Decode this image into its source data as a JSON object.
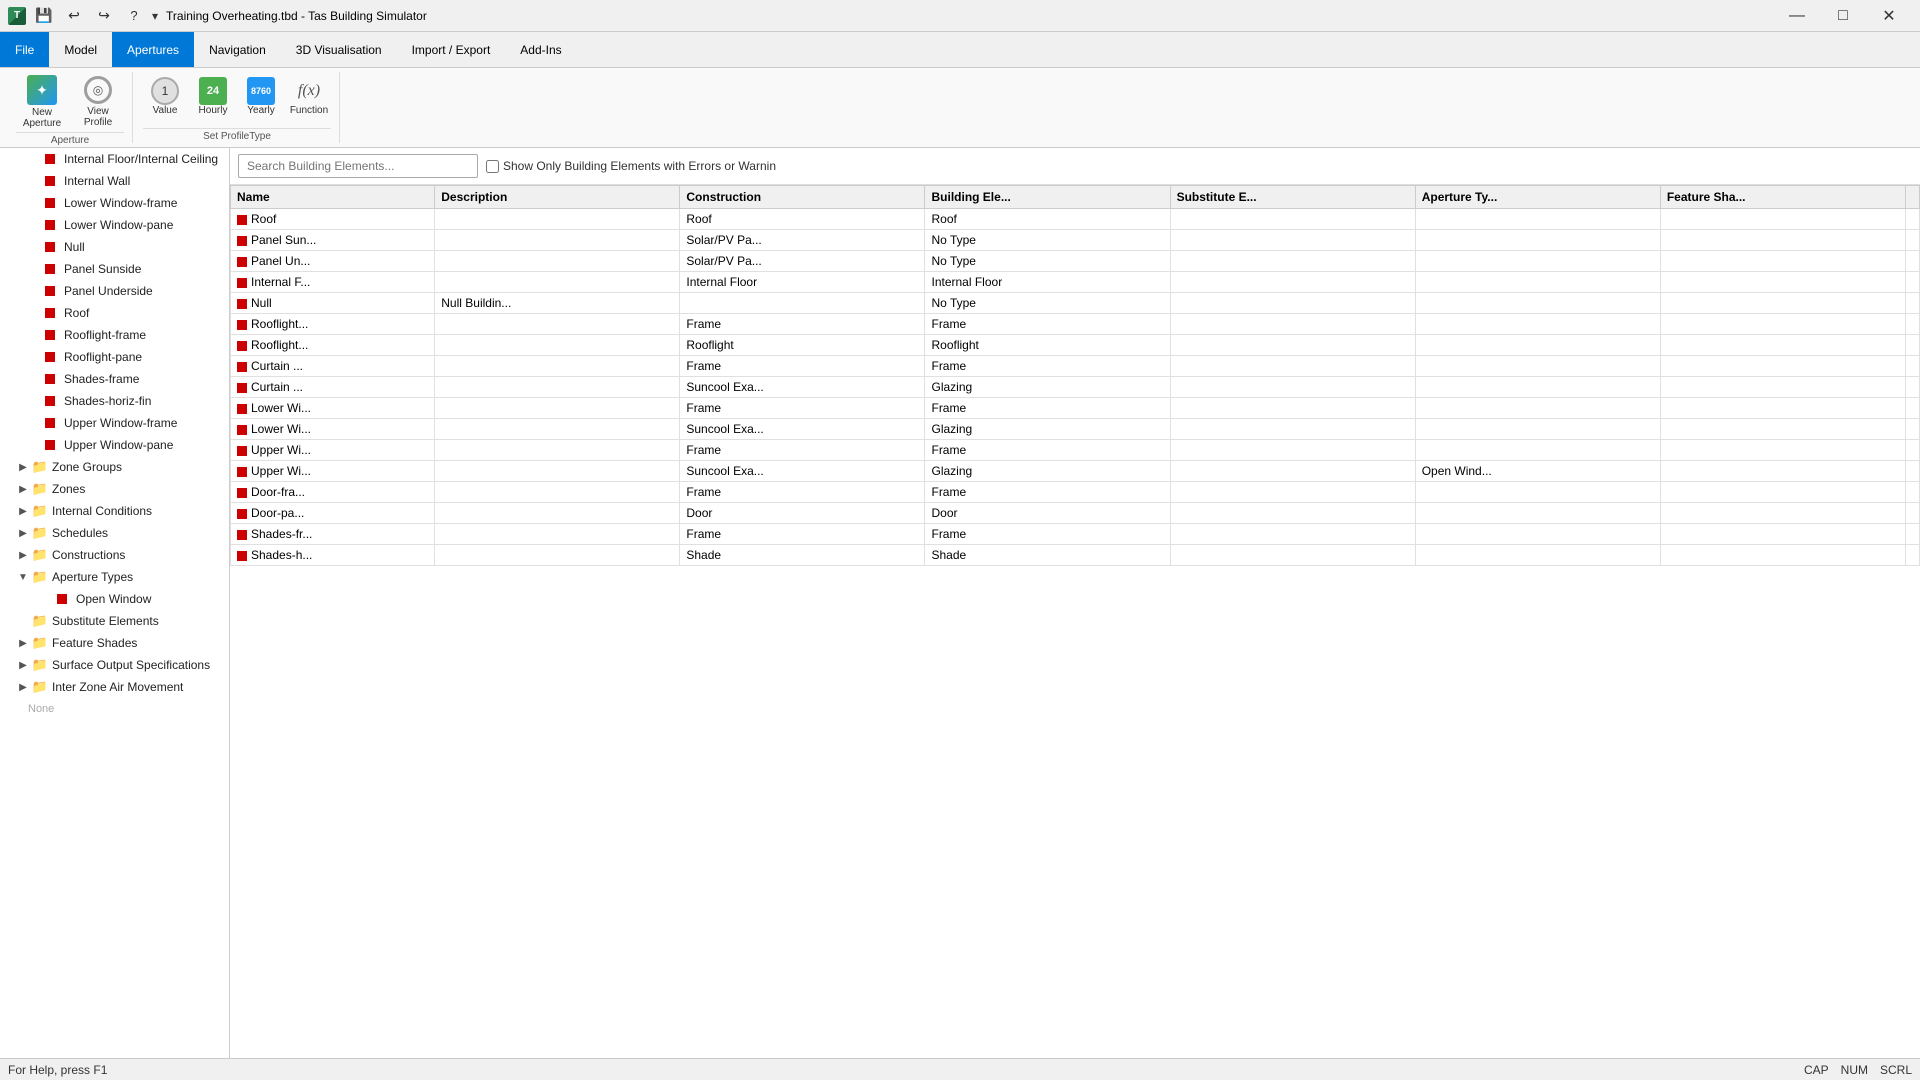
{
  "titleBar": {
    "title": "Training Overheating.tbd - Tas Building Simulator",
    "minimize": "—",
    "maximize": "□",
    "close": "✕"
  },
  "menuBar": {
    "items": [
      {
        "id": "file",
        "label": "File",
        "active": false
      },
      {
        "id": "model",
        "label": "Model",
        "active": false
      },
      {
        "id": "apertures",
        "label": "Apertures",
        "active": true
      },
      {
        "id": "navigation",
        "label": "Navigation",
        "active": false
      },
      {
        "id": "3d-vis",
        "label": "3D Visualisation",
        "active": false
      },
      {
        "id": "import-export",
        "label": "Import / Export",
        "active": false
      },
      {
        "id": "add-ins",
        "label": "Add-Ins",
        "active": false
      }
    ]
  },
  "ribbon": {
    "apertureGroup": {
      "label": "Aperture",
      "newApertureLabel": "New\nAperture",
      "viewProfileLabel": "View\nProfile"
    },
    "setProfileGroup": {
      "label": "Set ProfileType",
      "valueLabel": "Value",
      "hourlyLabel": "Hourly",
      "yearlyLabel": "Yearly",
      "functionLabel": "Function"
    }
  },
  "sidebar": {
    "items": [
      {
        "id": "internal-floor",
        "label": "Internal Floor/Internal Ceiling",
        "indent": 2,
        "type": "item",
        "icon": "red-sq"
      },
      {
        "id": "internal-wall",
        "label": "Internal Wall",
        "indent": 2,
        "type": "item",
        "icon": "red-sq"
      },
      {
        "id": "lower-window-frame",
        "label": "Lower Window-frame",
        "indent": 2,
        "type": "item",
        "icon": "red-sq"
      },
      {
        "id": "lower-window-pane",
        "label": "Lower Window-pane",
        "indent": 2,
        "type": "item",
        "icon": "red-sq"
      },
      {
        "id": "null",
        "label": "Null",
        "indent": 2,
        "type": "item",
        "icon": "red-sq"
      },
      {
        "id": "panel-sunside",
        "label": "Panel Sunside",
        "indent": 2,
        "type": "item",
        "icon": "red-sq"
      },
      {
        "id": "panel-underside",
        "label": "Panel Underside",
        "indent": 2,
        "type": "item",
        "icon": "red-sq"
      },
      {
        "id": "roof",
        "label": "Roof",
        "indent": 2,
        "type": "item",
        "icon": "red-sq"
      },
      {
        "id": "rooflight-frame",
        "label": "Rooflight-frame",
        "indent": 2,
        "type": "item",
        "icon": "red-sq"
      },
      {
        "id": "rooflight-pane",
        "label": "Rooflight-pane",
        "indent": 2,
        "type": "item",
        "icon": "red-sq"
      },
      {
        "id": "shades-frame",
        "label": "Shades-frame",
        "indent": 2,
        "type": "item",
        "icon": "red-sq"
      },
      {
        "id": "shades-horiz-fin",
        "label": "Shades-horiz-fin",
        "indent": 2,
        "type": "item",
        "icon": "red-sq"
      },
      {
        "id": "upper-window-frame",
        "label": "Upper Window-frame",
        "indent": 2,
        "type": "item",
        "icon": "red-sq"
      },
      {
        "id": "upper-window-pane",
        "label": "Upper Window-pane",
        "indent": 2,
        "type": "item",
        "icon": "red-sq"
      },
      {
        "id": "zone-groups",
        "label": "Zone Groups",
        "indent": 1,
        "type": "folder",
        "expanded": false
      },
      {
        "id": "zones",
        "label": "Zones",
        "indent": 1,
        "type": "folder",
        "expanded": false
      },
      {
        "id": "internal-conditions",
        "label": "Internal Conditions",
        "indent": 1,
        "type": "folder",
        "expanded": false
      },
      {
        "id": "schedules",
        "label": "Schedules",
        "indent": 1,
        "type": "folder",
        "expanded": false
      },
      {
        "id": "constructions",
        "label": "Constructions",
        "indent": 1,
        "type": "folder",
        "expanded": false
      },
      {
        "id": "aperture-types",
        "label": "Aperture Types",
        "indent": 1,
        "type": "folder",
        "expanded": true
      },
      {
        "id": "open-window",
        "label": "Open Window",
        "indent": 3,
        "type": "item-special",
        "icon": "red-sq"
      },
      {
        "id": "substitute-elements",
        "label": "Substitute Elements",
        "indent": 1,
        "type": "folder-plain",
        "expanded": false
      },
      {
        "id": "feature-shades",
        "label": "Feature Shades",
        "indent": 1,
        "type": "folder",
        "expanded": false
      },
      {
        "id": "surface-output-spec",
        "label": "Surface Output Specifications",
        "indent": 1,
        "type": "folder",
        "expanded": false
      },
      {
        "id": "inter-zone-air",
        "label": "Inter Zone Air Movement",
        "indent": 1,
        "type": "folder",
        "expanded": false
      }
    ]
  },
  "toolbar": {
    "searchPlaceholder": "Search Building Elements...",
    "checkboxLabel": "Show Only Building Elements with Errors or Warnin"
  },
  "table": {
    "columns": [
      "Name",
      "Description",
      "Construction",
      "Building Ele...",
      "Substitute E...",
      "Aperture Ty...",
      "Feature Sha..."
    ],
    "rows": [
      {
        "name": "Roof",
        "description": "",
        "construction": "Roof",
        "buildingEle": "Roof",
        "substituteE": "",
        "apertureTy": "",
        "featureSha": ""
      },
      {
        "name": "Panel Sun...",
        "description": "",
        "construction": "Solar/PV Pa...",
        "buildingEle": "No Type",
        "substituteE": "",
        "apertureTy": "",
        "featureSha": ""
      },
      {
        "name": "Panel Un...",
        "description": "",
        "construction": "Solar/PV Pa...",
        "buildingEle": "No Type",
        "substituteE": "",
        "apertureTy": "",
        "featureSha": ""
      },
      {
        "name": "Internal F...",
        "description": "",
        "construction": "Internal Floor",
        "buildingEle": "Internal Floor",
        "substituteE": "",
        "apertureTy": "",
        "featureSha": ""
      },
      {
        "name": "Null",
        "description": "Null Buildin...",
        "construction": "",
        "buildingEle": "No Type",
        "substituteE": "",
        "apertureTy": "",
        "featureSha": ""
      },
      {
        "name": "Rooflight...",
        "description": "",
        "construction": "Frame",
        "buildingEle": "Frame",
        "substituteE": "",
        "apertureTy": "",
        "featureSha": ""
      },
      {
        "name": "Rooflight...",
        "description": "",
        "construction": "Rooflight",
        "buildingEle": "Rooflight",
        "substituteE": "",
        "apertureTy": "",
        "featureSha": ""
      },
      {
        "name": "Curtain ...",
        "description": "",
        "construction": "Frame",
        "buildingEle": "Frame",
        "substituteE": "",
        "apertureTy": "",
        "featureSha": ""
      },
      {
        "name": "Curtain ...",
        "description": "",
        "construction": "Suncool Exa...",
        "buildingEle": "Glazing",
        "substituteE": "",
        "apertureTy": "",
        "featureSha": ""
      },
      {
        "name": "Lower Wi...",
        "description": "",
        "construction": "Frame",
        "buildingEle": "Frame",
        "substituteE": "",
        "apertureTy": "",
        "featureSha": ""
      },
      {
        "name": "Lower Wi...",
        "description": "",
        "construction": "Suncool Exa...",
        "buildingEle": "Glazing",
        "substituteE": "",
        "apertureTy": "",
        "featureSha": ""
      },
      {
        "name": "Upper Wi...",
        "description": "",
        "construction": "Frame",
        "buildingEle": "Frame",
        "substituteE": "",
        "apertureTy": "",
        "featureSha": ""
      },
      {
        "name": "Upper Wi...",
        "description": "",
        "construction": "Suncool Exa...",
        "buildingEle": "Glazing",
        "substituteE": "",
        "apertureTy": "Open Wind...",
        "featureSha": ""
      },
      {
        "name": "Door-fra...",
        "description": "",
        "construction": "Frame",
        "buildingEle": "Frame",
        "substituteE": "",
        "apertureTy": "",
        "featureSha": ""
      },
      {
        "name": "Door-pa...",
        "description": "",
        "construction": "Door",
        "buildingEle": "Door",
        "substituteE": "",
        "apertureTy": "",
        "featureSha": ""
      },
      {
        "name": "Shades-fr...",
        "description": "",
        "construction": "Frame",
        "buildingEle": "Frame",
        "substituteE": "",
        "apertureTy": "",
        "featureSha": ""
      },
      {
        "name": "Shades-h...",
        "description": "",
        "construction": "Shade",
        "buildingEle": "Shade",
        "substituteE": "",
        "apertureTy": "",
        "featureSha": ""
      }
    ]
  },
  "statusBar": {
    "helpText": "For Help, press F1",
    "bottomText": "None",
    "cap": "CAP",
    "num": "NUM",
    "scrl": "SCRL"
  }
}
